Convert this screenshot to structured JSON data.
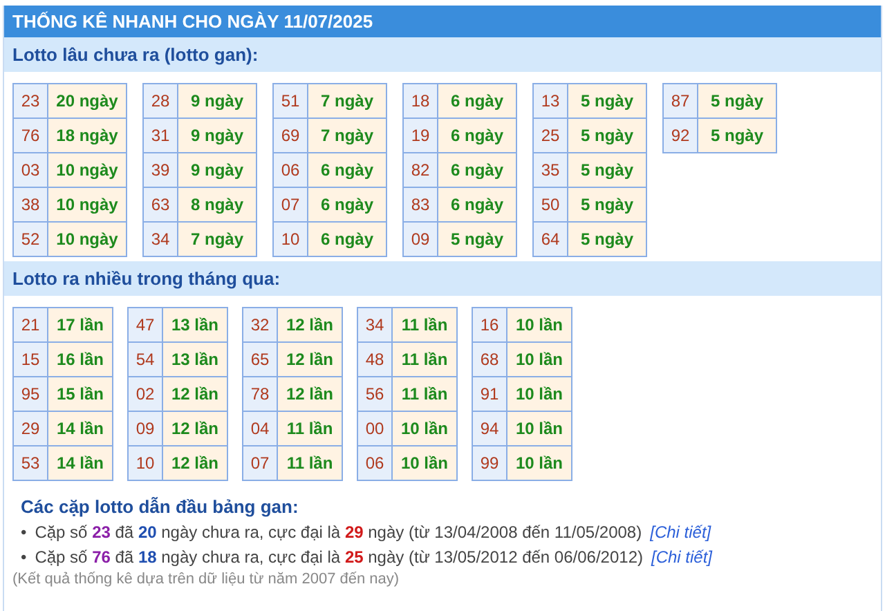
{
  "title": "THỐNG KÊ NHANH CHO NGÀY 11/07/2025",
  "sections": [
    {
      "heading": "Lotto lâu chưa ra (lotto gan):",
      "kind": "gan",
      "tables": [
        [
          [
            "23",
            "20 ngày"
          ],
          [
            "76",
            "18 ngày"
          ],
          [
            "03",
            "10 ngày"
          ],
          [
            "38",
            "10 ngày"
          ],
          [
            "52",
            "10 ngày"
          ]
        ],
        [
          [
            "28",
            "9 ngày"
          ],
          [
            "31",
            "9 ngày"
          ],
          [
            "39",
            "9 ngày"
          ],
          [
            "63",
            "8 ngày"
          ],
          [
            "34",
            "7 ngày"
          ]
        ],
        [
          [
            "51",
            "7 ngày"
          ],
          [
            "69",
            "7 ngày"
          ],
          [
            "06",
            "6 ngày"
          ],
          [
            "07",
            "6 ngày"
          ],
          [
            "10",
            "6 ngày"
          ]
        ],
        [
          [
            "18",
            "6 ngày"
          ],
          [
            "19",
            "6 ngày"
          ],
          [
            "82",
            "6 ngày"
          ],
          [
            "83",
            "6 ngày"
          ],
          [
            "09",
            "5 ngày"
          ]
        ],
        [
          [
            "13",
            "5 ngày"
          ],
          [
            "25",
            "5 ngày"
          ],
          [
            "35",
            "5 ngày"
          ],
          [
            "50",
            "5 ngày"
          ],
          [
            "64",
            "5 ngày"
          ]
        ],
        [
          [
            "87",
            "5 ngày"
          ],
          [
            "92",
            "5 ngày"
          ]
        ]
      ]
    },
    {
      "heading": "Lotto ra nhiều trong tháng qua:",
      "kind": "nhieu",
      "tables": [
        [
          [
            "21",
            "17 lần"
          ],
          [
            "15",
            "16 lần"
          ],
          [
            "95",
            "15 lần"
          ],
          [
            "29",
            "14 lần"
          ],
          [
            "53",
            "14 lần"
          ]
        ],
        [
          [
            "47",
            "13 lần"
          ],
          [
            "54",
            "13 lần"
          ],
          [
            "02",
            "12 lần"
          ],
          [
            "09",
            "12 lần"
          ],
          [
            "10",
            "12 lần"
          ]
        ],
        [
          [
            "32",
            "12 lần"
          ],
          [
            "65",
            "12 lần"
          ],
          [
            "78",
            "12 lần"
          ],
          [
            "04",
            "11 lần"
          ],
          [
            "07",
            "11 lần"
          ]
        ],
        [
          [
            "34",
            "11 lần"
          ],
          [
            "48",
            "11 lần"
          ],
          [
            "56",
            "11 lần"
          ],
          [
            "00",
            "10 lần"
          ],
          [
            "06",
            "10 lần"
          ]
        ],
        [
          [
            "16",
            "10 lần"
          ],
          [
            "68",
            "10 lần"
          ],
          [
            "91",
            "10 lần"
          ],
          [
            "94",
            "10 lần"
          ],
          [
            "99",
            "10 lần"
          ]
        ]
      ]
    }
  ],
  "leaders": {
    "heading": "Các cặp lotto dẫn đầu bảng gan:",
    "items": [
      {
        "bullet": "•",
        "parts": [
          {
            "kind": "plain",
            "text": "Cặp số "
          },
          {
            "kind": "pair",
            "text": "23"
          },
          {
            "kind": "plain",
            "text": " đã "
          },
          {
            "kind": "days",
            "text": "20"
          },
          {
            "kind": "plain",
            "text": " ngày chưa ra, cực đại là "
          },
          {
            "kind": "max",
            "text": "29"
          },
          {
            "kind": "plain",
            "text": " ngày (từ 13/04/2008 đến 11/05/2008) "
          }
        ],
        "link": "[Chi tiết]"
      },
      {
        "bullet": "•",
        "parts": [
          {
            "kind": "plain",
            "text": "Cặp số "
          },
          {
            "kind": "pair",
            "text": "76"
          },
          {
            "kind": "plain",
            "text": " đã "
          },
          {
            "kind": "days",
            "text": "18"
          },
          {
            "kind": "plain",
            "text": " ngày chưa ra, cực đại là "
          },
          {
            "kind": "max",
            "text": "25"
          },
          {
            "kind": "plain",
            "text": " ngày (từ 13/05/2012 đến 06/06/2012) "
          }
        ],
        "link": "[Chi tiết]"
      }
    ],
    "note": "(Kết quả thống kê dựa trên dữ liệu từ năm 2007 đến nay)"
  }
}
